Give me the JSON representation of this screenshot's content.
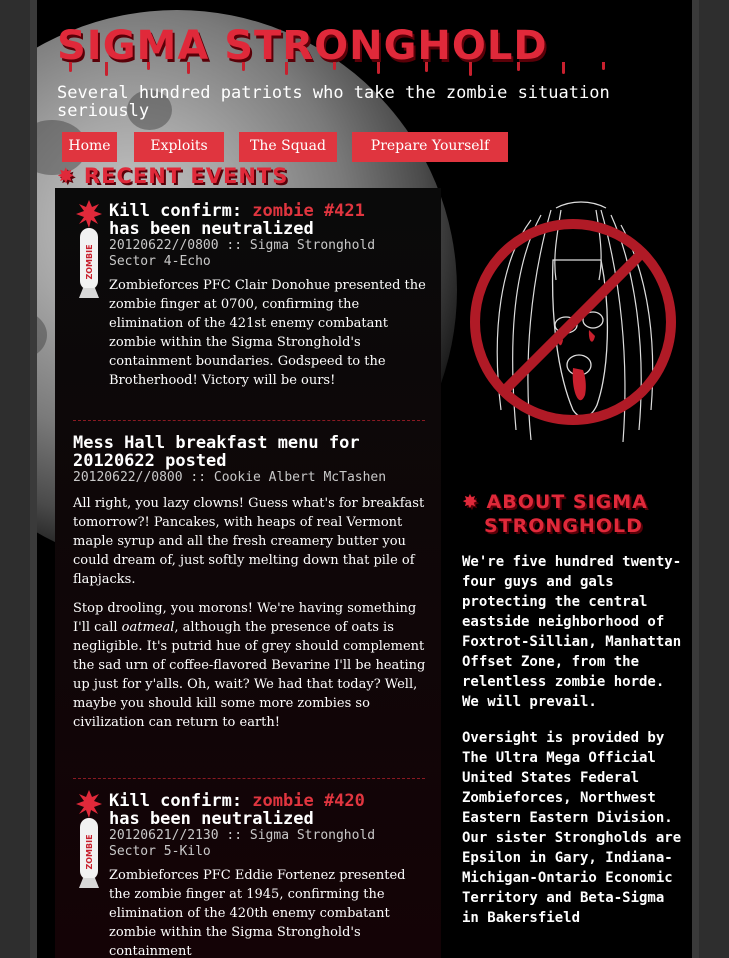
{
  "site": {
    "title": "SIGMA STRONGHOLD",
    "tagline": "Several hundred patriots who take the zombie situation seriously"
  },
  "nav": [
    {
      "label": "Home"
    },
    {
      "label": "Exploits"
    },
    {
      "label": "The Squad"
    },
    {
      "label": "Prepare Yourself"
    }
  ],
  "recent": {
    "heading": "RECENT EVENTS",
    "posts": [
      {
        "title_prefix": "Kill confirm: ",
        "title_link": "zombie #421",
        "title_suffix": "has been neutralized",
        "meta_date": "20120622//0800",
        "meta_sep": " :: ",
        "meta_author": "Sigma Stronghold",
        "meta_extra": "Sector 4-Echo",
        "badge": "ZOMBIE",
        "body": "Zombieforces PFC Clair Donohue presented the zombie finger at 0700, confirming the elimination of the 421st enemy combatant zombie within the Sigma Stronghold's containment boundaries. Godspeed to the Brotherhood! Victory will be ours!"
      },
      {
        "title": "Mess Hall breakfast menu for 20120622 posted",
        "meta_date": "20120622//0800",
        "meta_sep": " :: ",
        "meta_author": "Cookie Albert McTashen",
        "p1": "All right, you lazy clowns! Guess what's for breakfast tomorrow?! Pancakes, with heaps of real Vermont maple syrup and all the fresh creamery butter you could dream of, just softly melting down that pile of flapjacks.",
        "p2_a": "Stop drooling, you morons! We're having something I'll call ",
        "p2_em": "oatmeal",
        "p2_b": ", although the presence of oats is negligible. It's putrid hue of grey should complement the sad urn of coffee-flavored Bevarine I'll be heating up just for y'alls. Oh, wait? We had that today? Well, maybe you should kill some more zombies so civilization can return to earth!"
      },
      {
        "title_prefix": "Kill confirm: ",
        "title_link": "zombie #420",
        "title_suffix": "has been neutralized",
        "meta_date": "20120621//2130",
        "meta_sep": " :: ",
        "meta_author": "Sigma Stronghold",
        "meta_extra": "Sector 5-Kilo",
        "badge": "ZOMBIE",
        "body": "Zombieforces PFC Eddie Fortenez presented the zombie finger at 1945, confirming the elimination of the 420th enemy combatant zombie within the Sigma Stronghold's containment"
      }
    ]
  },
  "about": {
    "heading_line1": "ABOUT SIGMA",
    "heading_line2": "STRONGHOLD",
    "p1": "We're five hundred twenty-four guys and gals protecting the central eastside neighborhood of Foxtrot-Sillian, Manhattan Offset Zone, from the relentless zombie horde. We will prevail.",
    "p2": "Oversight is provided by The Ultra Mega Official United States Federal Zombieforces, Northwest Eastern Eastern Division. Our sister Strongholds are Epsilon in Gary, Indiana-Michigan-Ontario Economic Territory and Beta-Sigma in Bakersfield"
  },
  "colors": {
    "accent": "#e0293a",
    "background": "#000000",
    "frame": "#3a3a3a"
  },
  "icons": [
    "splat-icon",
    "bomb-icon",
    "no-zombie-icon"
  ]
}
